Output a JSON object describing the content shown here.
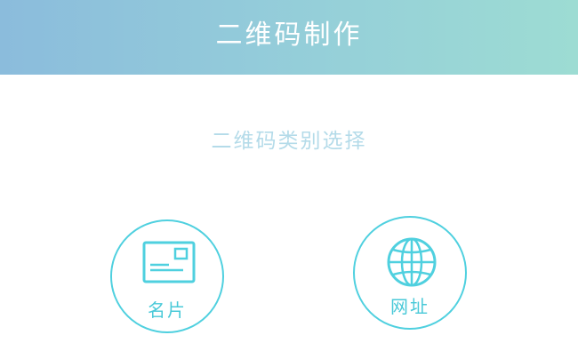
{
  "header": {
    "title": "二维码制作"
  },
  "main": {
    "section_title": "二维码类别选择",
    "options": [
      {
        "label": "名片",
        "icon": "business-card-icon"
      },
      {
        "label": "网址",
        "icon": "globe-icon"
      }
    ]
  },
  "colors": {
    "header_gradient_start": "#8bbcdc",
    "header_gradient_end": "#9ddcd3",
    "accent": "#4fd0df",
    "section_title": "#b4dbe9"
  }
}
